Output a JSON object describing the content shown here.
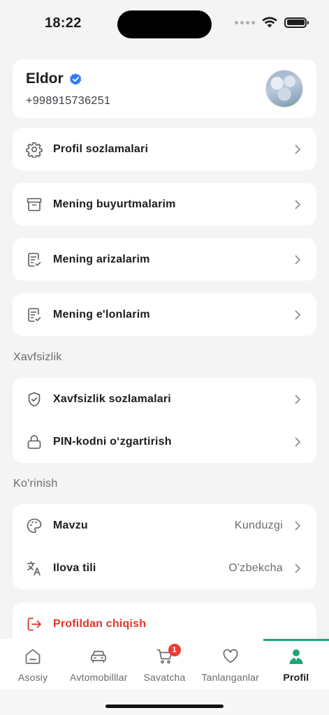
{
  "status_bar": {
    "time": "18:22"
  },
  "profile": {
    "name": "Eldor",
    "phone": "+998915736251",
    "verified": true
  },
  "menu": [
    {
      "id": "profile-settings",
      "label": "Profil sozlamalari",
      "icon": "gear-icon"
    },
    {
      "id": "my-orders",
      "label": "Mening buyurtmalarim",
      "icon": "archive-box-icon"
    },
    {
      "id": "my-applications",
      "label": "Mening arizalarim",
      "icon": "document-check-icon"
    },
    {
      "id": "my-listings",
      "label": "Mening e'lonlarim",
      "icon": "document-check-icon"
    }
  ],
  "security": {
    "title": "Xavfsizlik",
    "items": [
      {
        "id": "security-settings",
        "label": "Xavfsizlik sozlamalari",
        "icon": "shield-check-icon"
      },
      {
        "id": "change-pin",
        "label": "PIN-kodni oʻzgartirish",
        "icon": "lock-icon"
      }
    ]
  },
  "appearance": {
    "title": "Ko'rinish",
    "items": [
      {
        "id": "theme",
        "label": "Mavzu",
        "value": "Kunduzgi",
        "icon": "palette-icon"
      },
      {
        "id": "language",
        "label": "Ilova tili",
        "value": "O'zbekcha",
        "icon": "translate-icon"
      }
    ]
  },
  "logout": {
    "label": "Profildan chiqish",
    "icon": "logout-icon",
    "color": "#e0352b"
  },
  "tabs": [
    {
      "id": "home",
      "label": "Asosiy",
      "icon": "home-icon",
      "active": false
    },
    {
      "id": "cars",
      "label": "Avtomobilllar",
      "icon": "car-icon",
      "active": false
    },
    {
      "id": "cart",
      "label": "Savatcha",
      "icon": "cart-icon",
      "active": false,
      "badge": "1"
    },
    {
      "id": "favorites",
      "label": "Tanlanganlar",
      "icon": "heart-icon",
      "active": false
    },
    {
      "id": "profile",
      "label": "Profil",
      "icon": "person-icon",
      "active": true
    }
  ],
  "colors": {
    "accent": "#1fa37a",
    "verified": "#2f7bf6",
    "danger": "#e0352b",
    "badge": "#ef3b34",
    "background": "#f4f4f5"
  }
}
